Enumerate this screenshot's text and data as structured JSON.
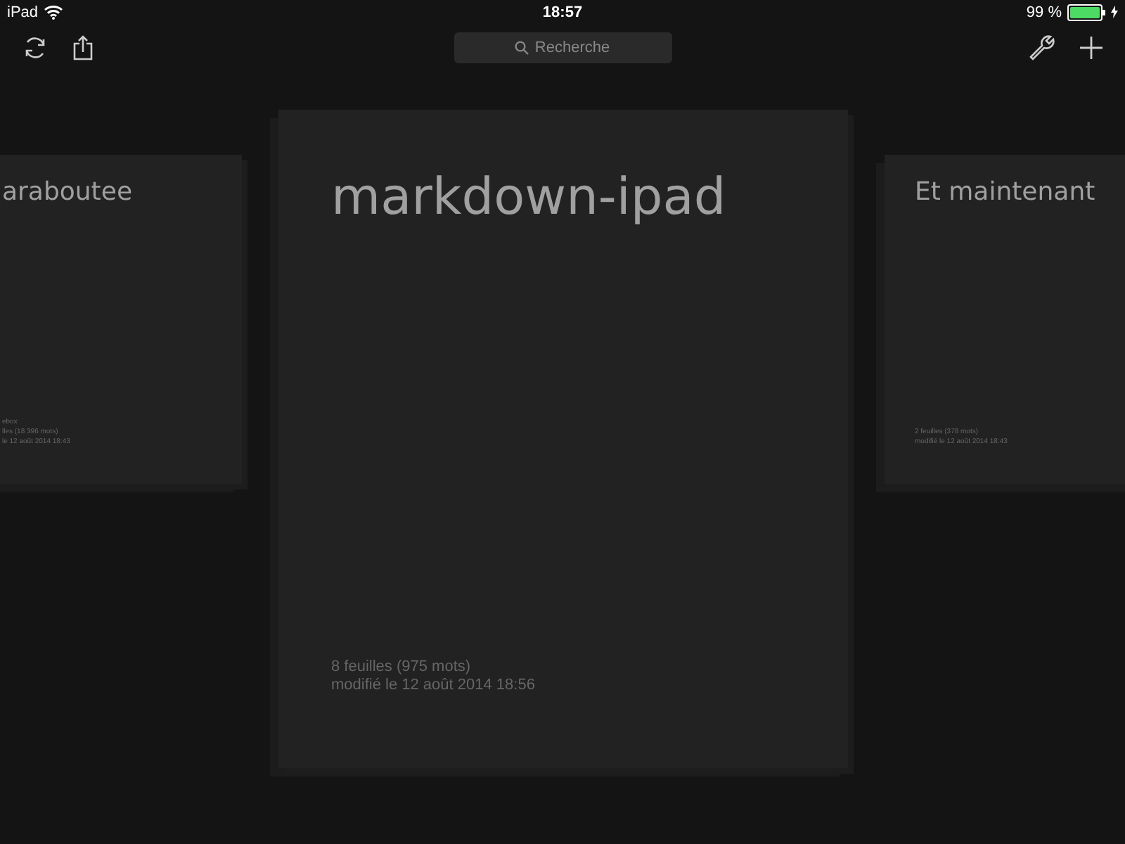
{
  "status_bar": {
    "device": "iPad",
    "time": "18:57",
    "battery_percent": "99 %",
    "battery": {
      "level": 0.99
    },
    "charging": true
  },
  "toolbar": {
    "search": {
      "placeholder": "Recherche"
    }
  },
  "documents": [
    {
      "title": "araboutee",
      "lines": [
        "ebox",
        "lles (18 396 mots)",
        "le 12 août 2014 18:43"
      ],
      "selected": false
    },
    {
      "title": "markdown-ipad",
      "lines": [
        "8 feuilles (975 mots)",
        "modifié le 12 août 2014 18:56"
      ],
      "selected": true
    },
    {
      "title": "Et maintenant",
      "lines": [
        "2 feuilles (378 mots)",
        "modifié le 12 août 2014 18:43"
      ],
      "selected": false
    }
  ]
}
